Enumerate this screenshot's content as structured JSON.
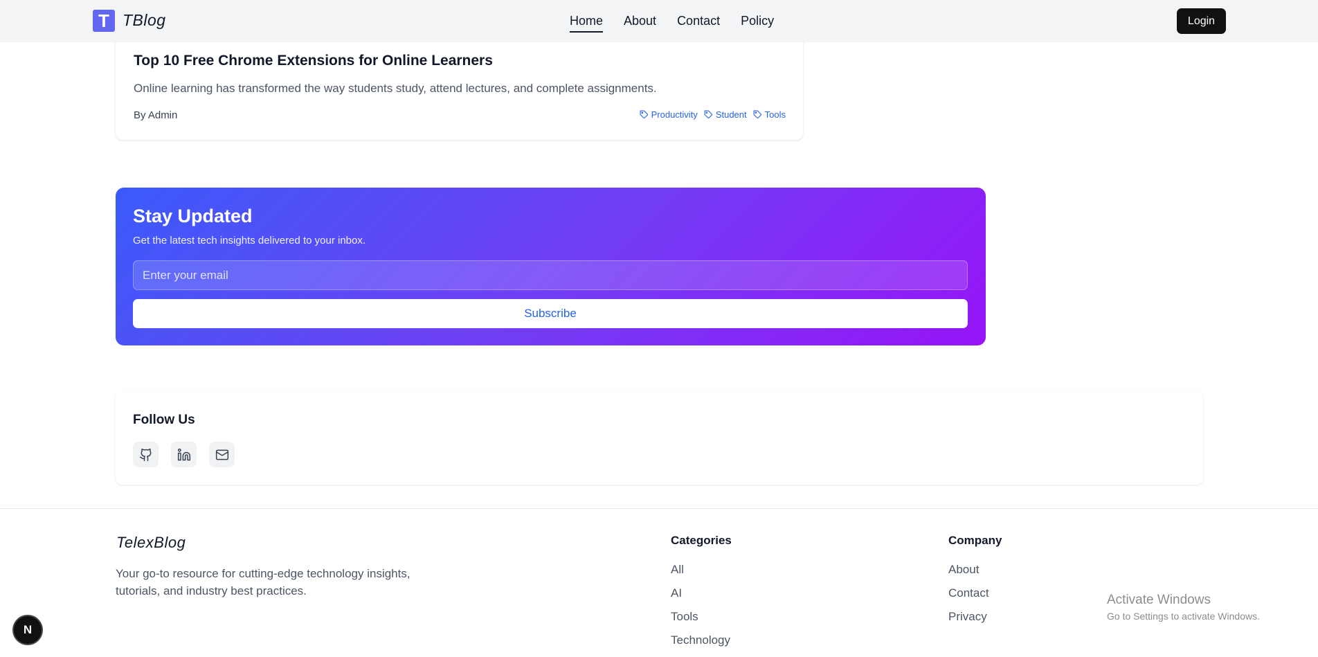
{
  "header": {
    "logo_letter": "T",
    "brand": "TBlog",
    "nav": [
      "Home",
      "About",
      "Contact",
      "Policy"
    ],
    "active_nav": "Home",
    "login_label": "Login"
  },
  "article": {
    "title": "Top 10 Free Chrome Extensions for Online Learners",
    "excerpt": "Online learning has transformed the way students study, attend lectures, and complete assignments.",
    "author": "By Admin",
    "tags": [
      "Productivity",
      "Student",
      "Tools"
    ]
  },
  "newsletter": {
    "title": "Stay Updated",
    "subtitle": "Get the latest tech insights delivered to your inbox.",
    "email_placeholder": "Enter your email",
    "subscribe_label": "Subscribe"
  },
  "follow": {
    "title": "Follow Us",
    "icons": [
      "github-icon",
      "linkedin-icon",
      "mail-icon"
    ]
  },
  "footer": {
    "brand": "TelexBlog",
    "description": "Your go-to resource for cutting-edge technology insights, tutorials, and industry best practices.",
    "categories_title": "Categories",
    "categories": [
      "All",
      "AI",
      "Tools",
      "Technology"
    ],
    "company_title": "Company",
    "company": [
      "About",
      "Contact",
      "Privacy"
    ]
  },
  "watermark": {
    "title": "Activate Windows",
    "subtitle": "Go to Settings to activate Windows."
  },
  "next_badge": "N",
  "colors": {
    "logo": "#6366f1",
    "tag": "#2563eb",
    "gradient_start": "#3b5bfa",
    "gradient_end": "#9614f7"
  }
}
